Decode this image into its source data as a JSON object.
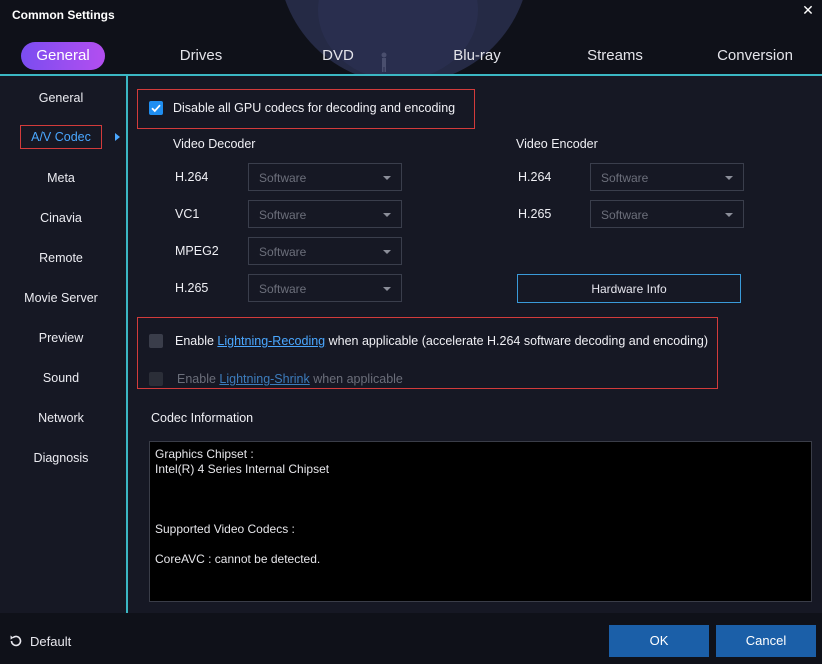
{
  "window": {
    "title": "Common Settings",
    "close_glyph": "✕"
  },
  "tabs": [
    {
      "label": "General",
      "active": true
    },
    {
      "label": "Drives"
    },
    {
      "label": "DVD"
    },
    {
      "label": "Blu-ray"
    },
    {
      "label": "Streams"
    },
    {
      "label": "Conversion"
    }
  ],
  "sidebar": {
    "items": [
      {
        "label": "General"
      },
      {
        "label": "A/V Codec",
        "active": true
      },
      {
        "label": "Meta"
      },
      {
        "label": "Cinavia"
      },
      {
        "label": "Remote"
      },
      {
        "label": "Movie Server"
      },
      {
        "label": "Preview"
      },
      {
        "label": "Sound"
      },
      {
        "label": "Network"
      },
      {
        "label": "Diagnosis"
      }
    ]
  },
  "codec": {
    "disable_gpu": {
      "label": "Disable all GPU codecs for decoding and encoding",
      "checked": true
    },
    "decoder": {
      "title": "Video Decoder",
      "rows": [
        {
          "label": "H.264",
          "value": "Software"
        },
        {
          "label": "VC1",
          "value": "Software"
        },
        {
          "label": "MPEG2",
          "value": "Software"
        },
        {
          "label": "H.265",
          "value": "Software"
        }
      ]
    },
    "encoder": {
      "title": "Video Encoder",
      "rows": [
        {
          "label": "H.264",
          "value": "Software"
        },
        {
          "label": "H.265",
          "value": "Software"
        }
      ]
    },
    "hardware_info_button": "Hardware Info",
    "lightning_recoding": {
      "prefix": "Enable ",
      "link": "Lightning-Recoding",
      "suffix": " when applicable (accelerate H.264 software decoding and encoding)",
      "checked": false
    },
    "lightning_shrink": {
      "prefix": "Enable ",
      "link": "Lightning-Shrink",
      "suffix": " when applicable",
      "checked": false,
      "disabled": true
    },
    "info_title": "Codec Information",
    "info_lines": [
      "Graphics Chipset :",
      "Intel(R) 4 Series Internal Chipset",
      "",
      "",
      "",
      "Supported Video Codecs :",
      "",
      "CoreAVC : cannot be detected."
    ]
  },
  "footer": {
    "default_label": "Default",
    "ok_label": "OK",
    "cancel_label": "Cancel"
  },
  "colors": {
    "accent_cyan": "#3bb7c4",
    "tab_gradient_start": "#7b4df0",
    "tab_gradient_end": "#b34ef0",
    "link_blue": "#4aa7ff",
    "highlight_red": "#d23b3b",
    "button_blue": "#1b5fa8"
  }
}
